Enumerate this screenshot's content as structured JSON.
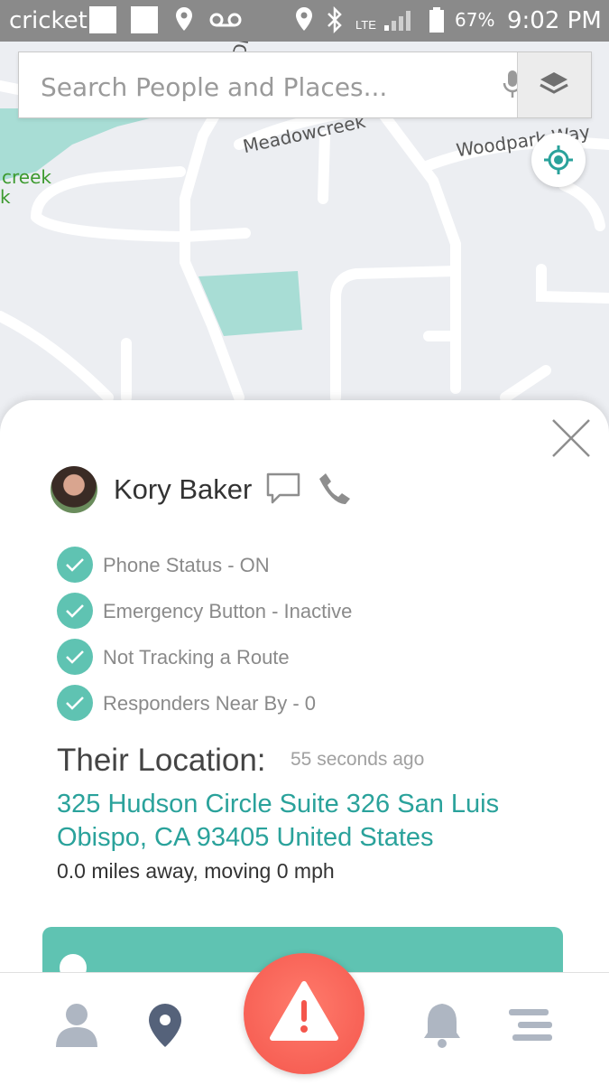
{
  "status_bar": {
    "carrier": "cricket",
    "battery_percent": "67%",
    "time": "9:02 PM",
    "network": "LTE"
  },
  "map": {
    "street_labels": [
      "Meadowcreek",
      "Woodpark Way",
      "Dr",
      "creek",
      "k"
    ]
  },
  "search": {
    "placeholder": "Search People and Places..."
  },
  "contact": {
    "name": "Kory Baker"
  },
  "status_items": [
    {
      "label": "Phone Status - ON"
    },
    {
      "label": "Emergency Button - Inactive"
    },
    {
      "label": "Not Tracking a Route"
    },
    {
      "label": "Responders Near By - 0"
    }
  ],
  "location": {
    "title": "Their Location:",
    "updated": "55 seconds ago",
    "address": "325 Hudson Circle Suite 326 San Luis Obispo, CA 93405 United States",
    "distance": "0.0 miles away, moving 0 mph"
  },
  "colors": {
    "accent": "#5fc3b2",
    "address": "#2aa29b",
    "alert": "#f4564c"
  },
  "nav": [
    "person-icon",
    "location-pin-icon",
    "alert-icon",
    "bell-icon",
    "menu-icon"
  ]
}
